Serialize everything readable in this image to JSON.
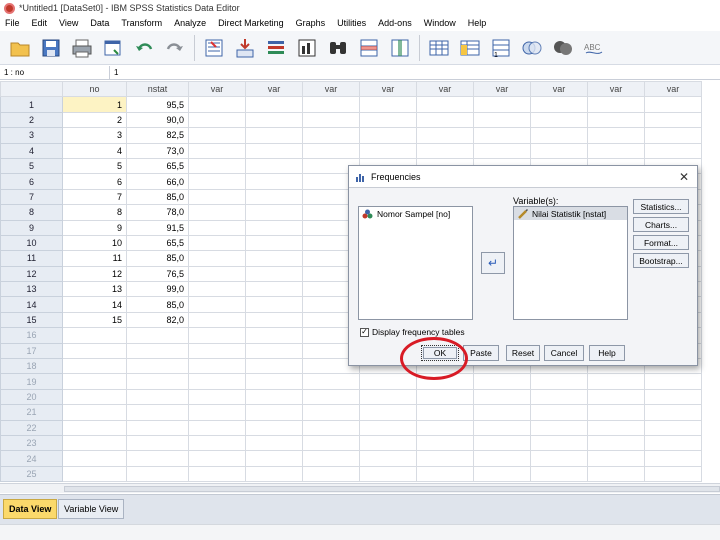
{
  "window": {
    "title": "*Untitled1 [DataSet0] - IBM SPSS Statistics Data Editor"
  },
  "menu": [
    "File",
    "Edit",
    "View",
    "Data",
    "Transform",
    "Analyze",
    "Direct Marketing",
    "Graphs",
    "Utilities",
    "Add-ons",
    "Window",
    "Help"
  ],
  "cell_editor": {
    "ref": "1 : no",
    "value": "1"
  },
  "columns": [
    "no",
    "nstat",
    "var",
    "var",
    "var",
    "var",
    "var",
    "var",
    "var",
    "var",
    "var"
  ],
  "rows": [
    {
      "id": "1",
      "no": "1",
      "nstat": "95,5"
    },
    {
      "id": "2",
      "no": "2",
      "nstat": "90,0"
    },
    {
      "id": "3",
      "no": "3",
      "nstat": "82,5"
    },
    {
      "id": "4",
      "no": "4",
      "nstat": "73,0"
    },
    {
      "id": "5",
      "no": "5",
      "nstat": "65,5"
    },
    {
      "id": "6",
      "no": "6",
      "nstat": "66,0"
    },
    {
      "id": "7",
      "no": "7",
      "nstat": "85,0"
    },
    {
      "id": "8",
      "no": "8",
      "nstat": "78,0"
    },
    {
      "id": "9",
      "no": "9",
      "nstat": "91,5"
    },
    {
      "id": "10",
      "no": "10",
      "nstat": "65,5"
    },
    {
      "id": "11",
      "no": "11",
      "nstat": "85,0"
    },
    {
      "id": "12",
      "no": "12",
      "nstat": "76,5"
    },
    {
      "id": "13",
      "no": "13",
      "nstat": "99,0"
    },
    {
      "id": "14",
      "no": "14",
      "nstat": "85,0"
    },
    {
      "id": "15",
      "no": "15",
      "nstat": "82,0"
    },
    {
      "id": "16",
      "no": "",
      "nstat": ""
    },
    {
      "id": "17",
      "no": "",
      "nstat": ""
    },
    {
      "id": "18",
      "no": "",
      "nstat": ""
    },
    {
      "id": "19",
      "no": "",
      "nstat": ""
    },
    {
      "id": "20",
      "no": "",
      "nstat": ""
    },
    {
      "id": "21",
      "no": "",
      "nstat": ""
    },
    {
      "id": "22",
      "no": "",
      "nstat": ""
    },
    {
      "id": "23",
      "no": "",
      "nstat": ""
    },
    {
      "id": "24",
      "no": "",
      "nstat": ""
    },
    {
      "id": "25",
      "no": "",
      "nstat": ""
    }
  ],
  "tabs": {
    "data_view": "Data View",
    "variable_view": "Variable View"
  },
  "dialog": {
    "title": "Frequencies",
    "source_list": [
      "Nomor Sampel [no]"
    ],
    "variables_label": "Variable(s):",
    "variables_list": [
      "Nilai Statistik [nstat]"
    ],
    "side_buttons": [
      "Statistics...",
      "Charts...",
      "Format...",
      "Bootstrap..."
    ],
    "checkbox_label": "Display frequency tables",
    "checkbox_checked": true,
    "buttons": {
      "ok": "OK",
      "paste": "Paste",
      "reset": "Reset",
      "cancel": "Cancel",
      "help": "Help"
    }
  },
  "colors": {
    "selected_cell": "#fdf3c4",
    "active_tab": "#fbd96b",
    "annotation": "#d81b25"
  }
}
